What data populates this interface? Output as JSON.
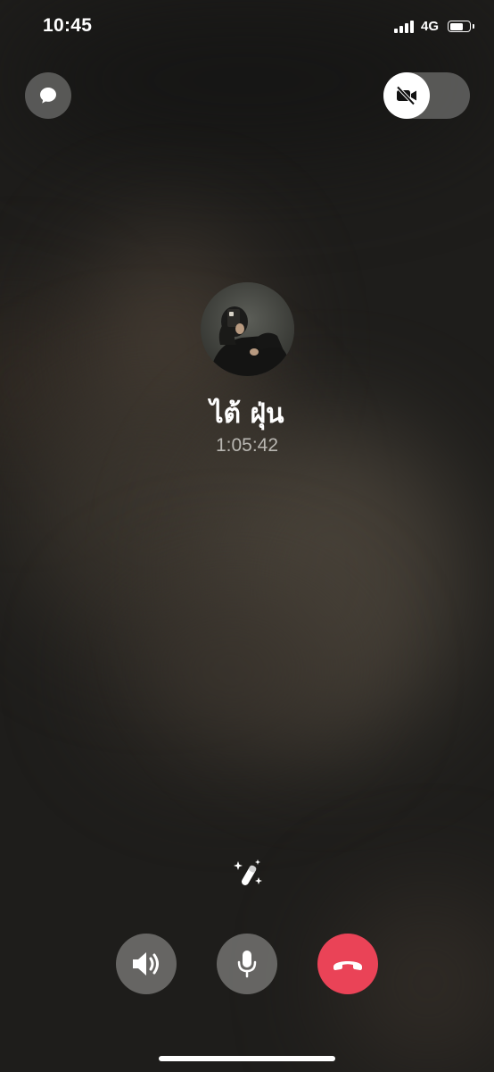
{
  "status_bar": {
    "time": "10:45",
    "network": "4G",
    "signal_bars": 4,
    "battery_level": 0.7
  },
  "top_controls": {
    "chat_icon": "chat-bubble-icon",
    "video_icon": "video-off-icon",
    "video_enabled": false
  },
  "caller": {
    "name": "ไต้ ฝุ่น",
    "duration": "1:05:42",
    "avatar_icon": "avatar"
  },
  "effects": {
    "icon": "magic-wand-sparkles-icon"
  },
  "controls": {
    "speaker_icon": "speaker-icon",
    "mic_icon": "microphone-icon",
    "end_call_icon": "end-call-icon",
    "end_call_color": "#ea4357"
  }
}
